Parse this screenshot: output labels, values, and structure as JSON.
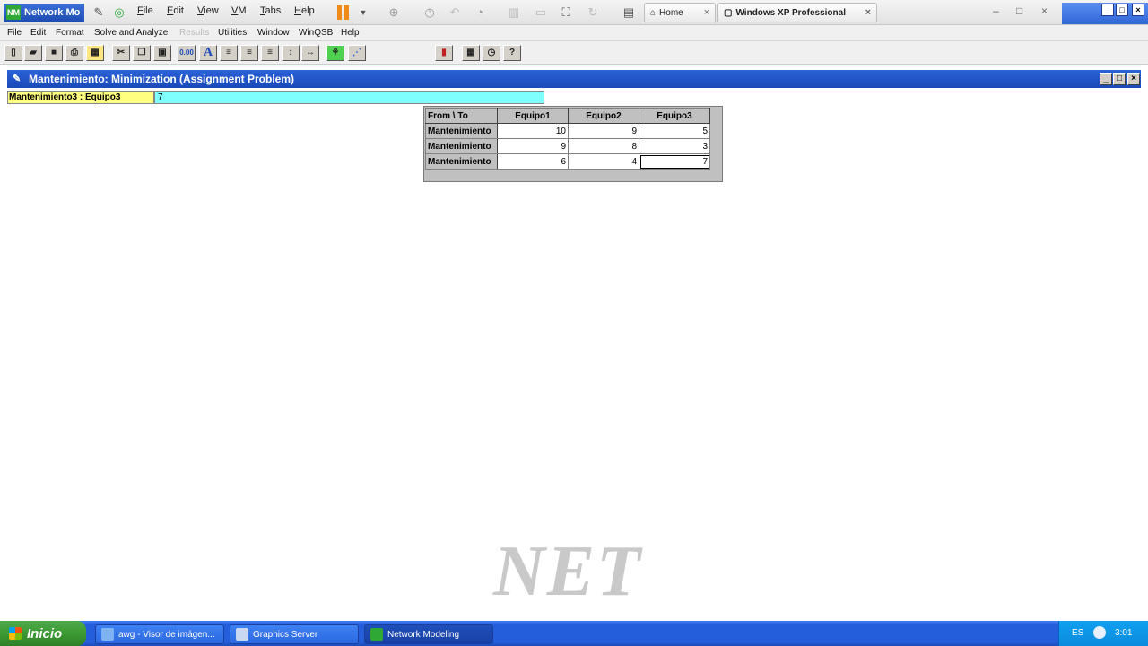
{
  "vmware": {
    "app_badge": "Network Mo",
    "menus": [
      "File",
      "Edit",
      "View",
      "VM",
      "Tabs",
      "Help"
    ],
    "tabs": [
      {
        "label": "Home",
        "close": "×"
      },
      {
        "label": "Windows XP Professional",
        "close": "×"
      }
    ],
    "window_controls": [
      "–",
      "□",
      "×"
    ],
    "guest_controls": [
      "_",
      "□",
      "×"
    ]
  },
  "menu_bar": {
    "items": [
      "File",
      "Edit",
      "Format",
      "Solve and Analyze",
      "Results",
      "Utilities",
      "Window",
      "WinQSB",
      "Help"
    ]
  },
  "toolbar": {
    "font_label": "A"
  },
  "child_window": {
    "title": "Mantenimiento: Minimization (Assignment Problem)",
    "controls": [
      "_",
      "□",
      "×"
    ]
  },
  "cell_editor": {
    "reference": "Mantenimiento3 : Equipo3",
    "value": "7"
  },
  "grid": {
    "corner": "From \\ To",
    "columns": [
      "Equipo1",
      "Equipo2",
      "Equipo3"
    ],
    "rows": [
      {
        "label": "Mantenimiento",
        "values": [
          "10",
          "9",
          "5"
        ]
      },
      {
        "label": "Mantenimiento",
        "values": [
          "9",
          "8",
          "3"
        ]
      },
      {
        "label": "Mantenimiento",
        "values": [
          "6",
          "4",
          "7"
        ]
      }
    ]
  },
  "watermark": "NET",
  "taskbar": {
    "start_label": "Inicio",
    "tasks": [
      "awg - Visor de imágen...",
      "Graphics Server",
      "Network Modeling"
    ],
    "lang": "ES",
    "clock": "3:01"
  },
  "colors": {
    "title_blue": "#1b49b8",
    "cell_ref_yellow": "#ffff80",
    "cell_entry_cyan": "#80ffff",
    "start_green": "#3b9a33"
  }
}
